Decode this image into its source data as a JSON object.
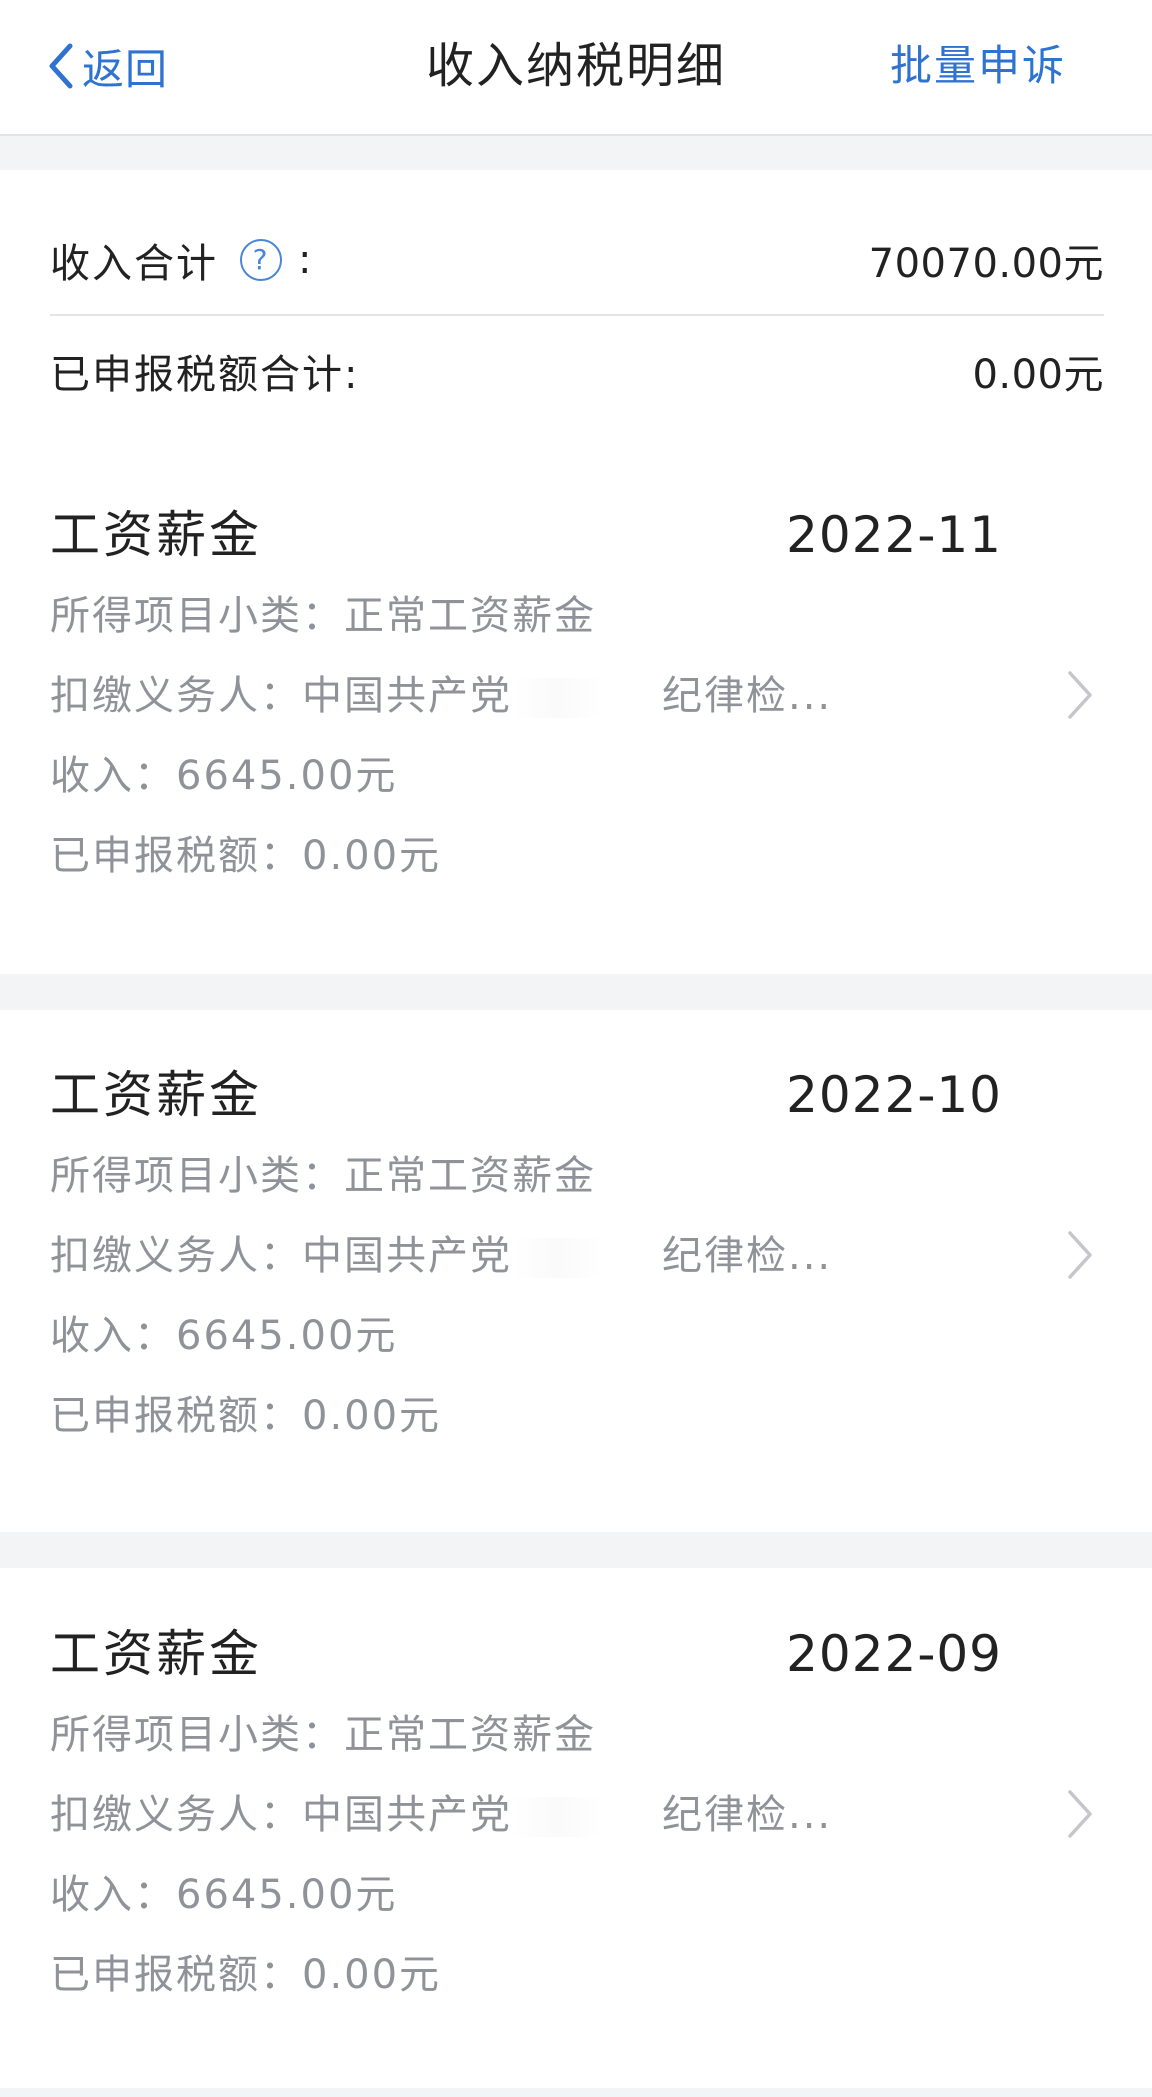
{
  "header": {
    "back_label": "返回",
    "title": "收入纳税明细",
    "action_label": "批量申诉"
  },
  "summary": {
    "income_total_label": "收入合计",
    "income_total_value": "70070.00元",
    "tax_total_label": "已申报税额合计:",
    "tax_total_value": "0.00元"
  },
  "records": [
    {
      "title": "工资薪金",
      "period": "2022-11",
      "subcategory": "所得项目小类：正常工资薪金",
      "withholder": "扣缴义务人：中国共产党",
      "withholder_tail": "纪律检...",
      "income": "收入：6645.00元",
      "tax": "已申报税额：0.00元"
    },
    {
      "title": "工资薪金",
      "period": "2022-10",
      "subcategory": "所得项目小类：正常工资薪金",
      "withholder": "扣缴义务人：中国共产党",
      "withholder_tail": "纪律检...",
      "income": "收入：6645.00元",
      "tax": "已申报税额：0.00元"
    },
    {
      "title": "工资薪金",
      "period": "2022-09",
      "subcategory": "所得项目小类：正常工资薪金",
      "withholder": "扣缴义务人：中国共产党",
      "withholder_tail": "纪律检...",
      "income": "收入：6645.00元",
      "tax": "已申报税额：0.00元"
    }
  ],
  "icons": {
    "back": "chevron-left-icon",
    "help": "question-circle-icon",
    "row_arrow": "chevron-right-icon"
  },
  "colors": {
    "accent": "#2f73d0",
    "text": "#222222",
    "secondary_text": "#8f9298",
    "background_gap": "#f3f4f6"
  }
}
